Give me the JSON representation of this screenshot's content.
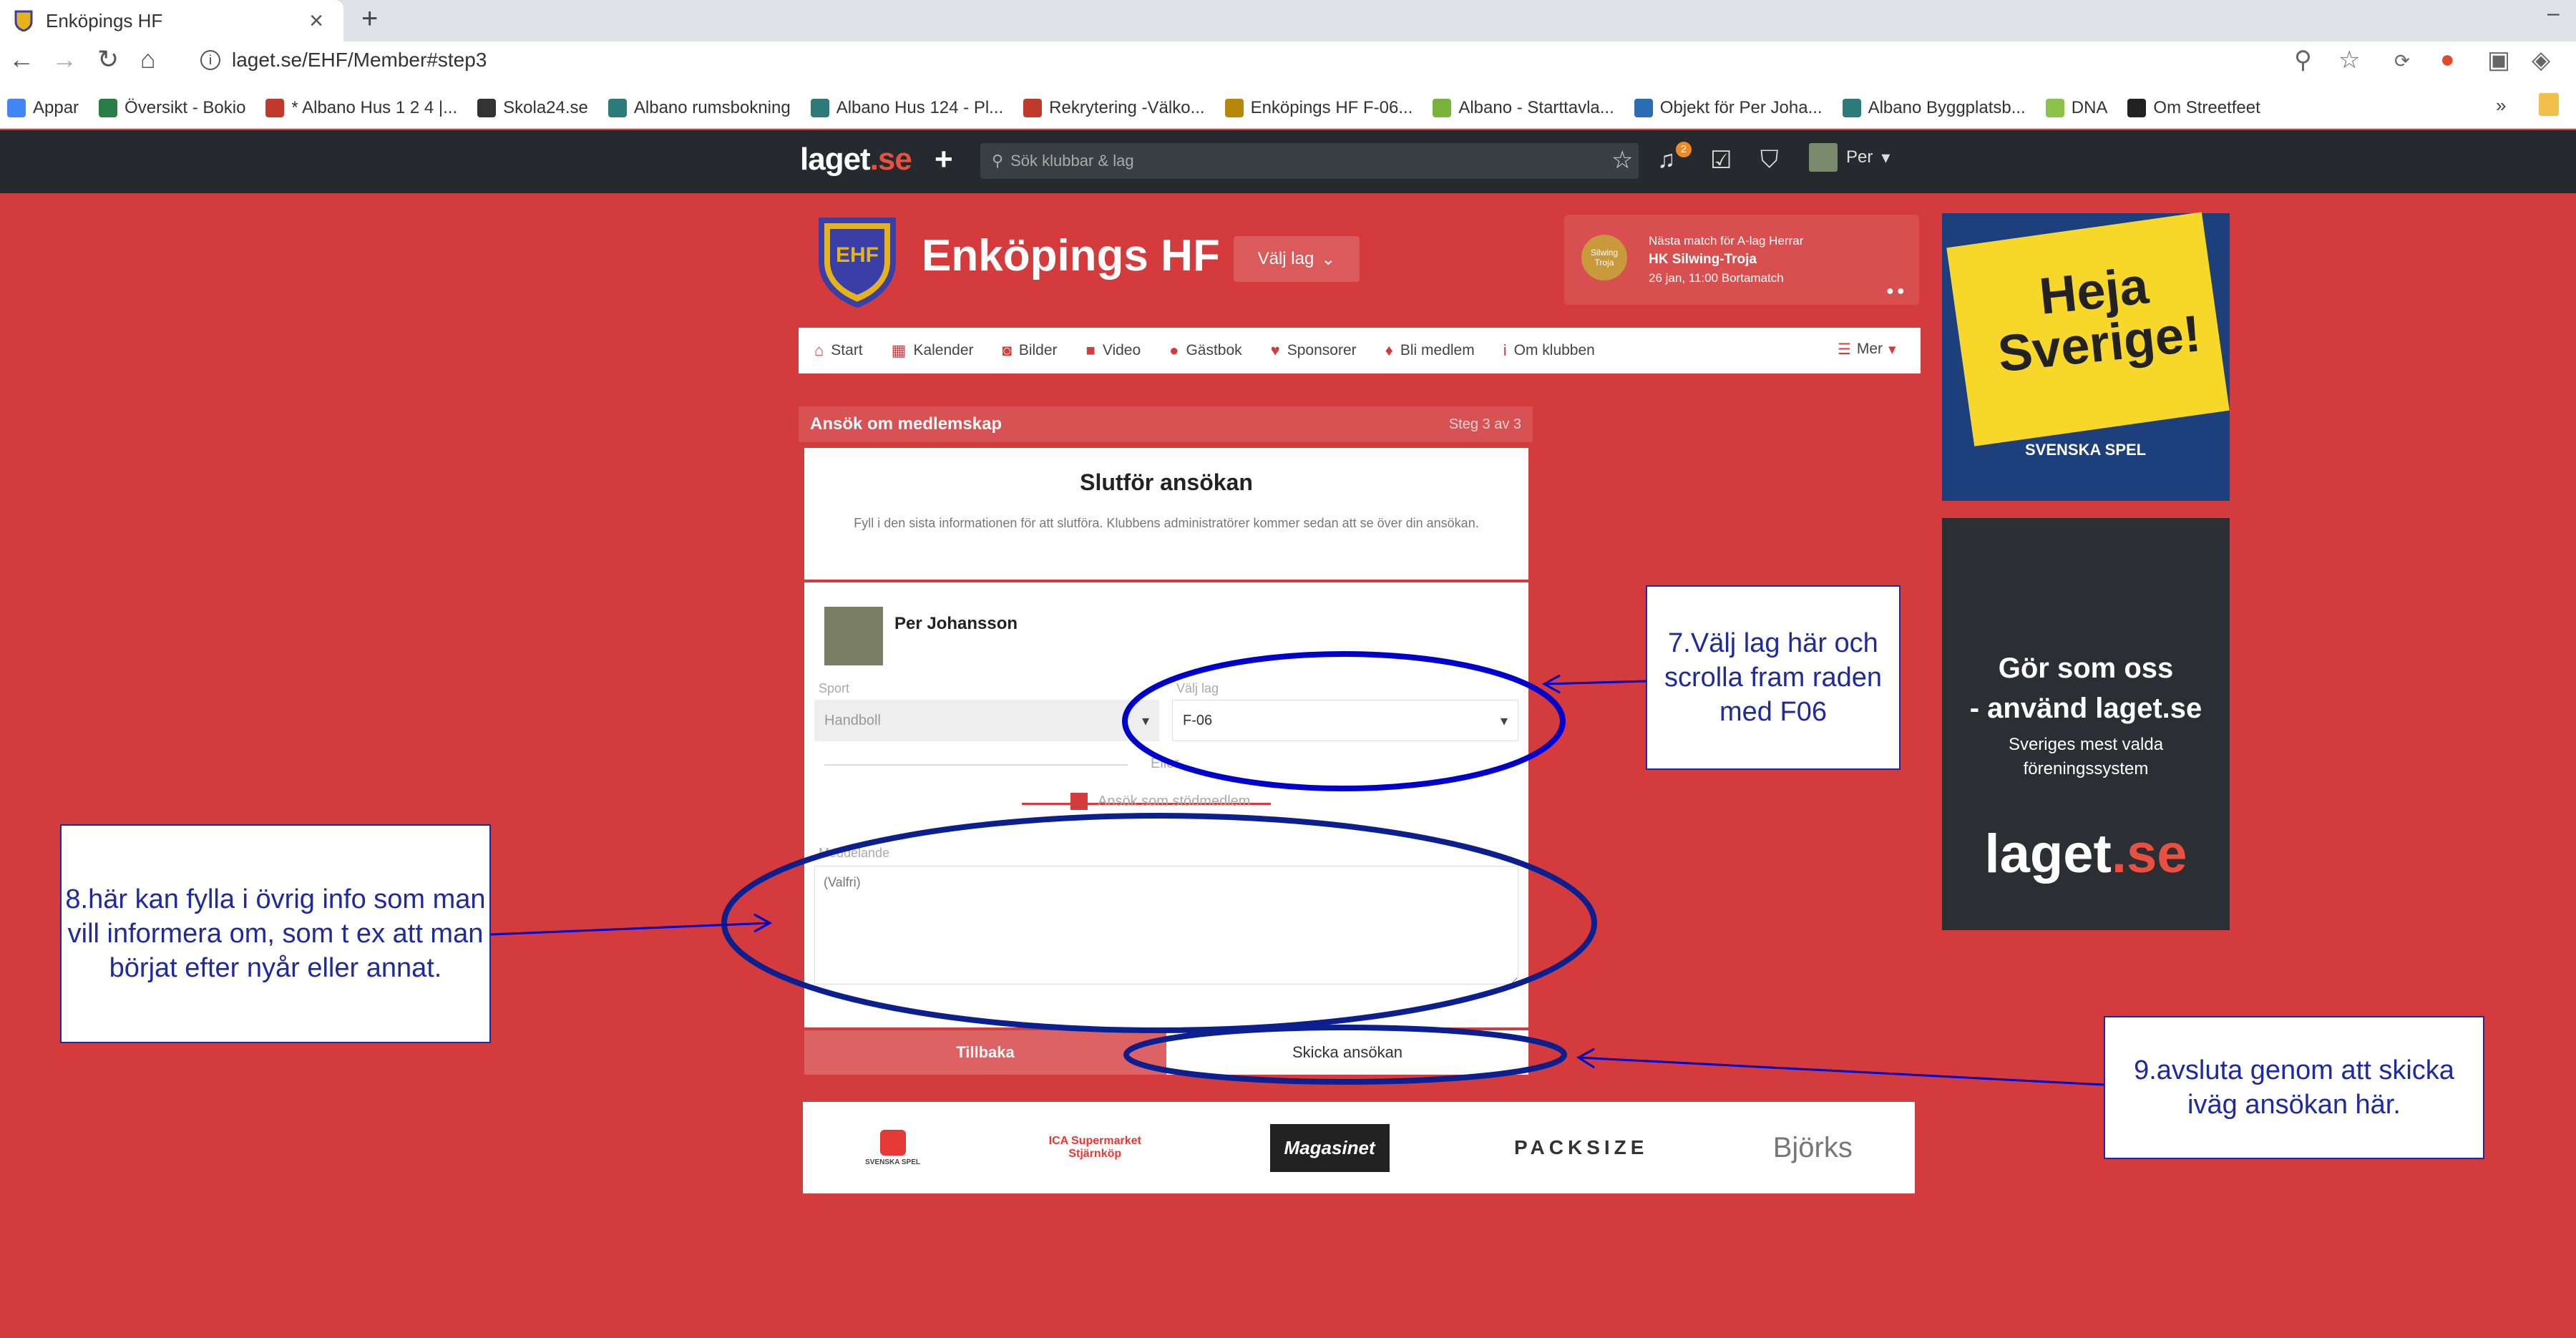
{
  "browser": {
    "tab_title": "Enköpings HF",
    "tab_close": "×",
    "new_tab": "+",
    "url": "laget.se/EHF/Member#step3",
    "bookmarks": [
      {
        "label": "Appar",
        "color": "#4285f4"
      },
      {
        "label": "Översikt - Bokio",
        "color": "#2a7d46"
      },
      {
        "label": "* Albano Hus 1 2 4 |...",
        "color": "#c0392b"
      },
      {
        "label": "Skola24.se",
        "color": "#333333"
      },
      {
        "label": "Albano rumsbokning",
        "color": "#2d7a7a"
      },
      {
        "label": "Albano Hus 124 - Pl...",
        "color": "#2d7a7a"
      },
      {
        "label": "Rekrytering -Välko...",
        "color": "#c0392b"
      },
      {
        "label": "Enköpings HF F-06...",
        "color": "#b8860b"
      },
      {
        "label": "Albano - Starttavla...",
        "color": "#7ab33c"
      },
      {
        "label": "Objekt för Per Joha...",
        "color": "#2a6db5"
      },
      {
        "label": "Albano Byggplatsb...",
        "color": "#2d7a7a"
      },
      {
        "label": "DNA",
        "color": "#8bc34a"
      },
      {
        "label": "Om Streetfeet",
        "color": "#222222"
      }
    ],
    "bookmarks_more": "»"
  },
  "laget": {
    "logo": "laget",
    "logo_suffix": ".se",
    "search_placeholder": "Sök klubbar & lag",
    "notification_count": "2",
    "user_name": "Per"
  },
  "club": {
    "name": "Enköpings HF",
    "crest_letters": "EHF",
    "select_team": "Välj lag",
    "next_match_label": "Nästa match för A-lag Herrar",
    "next_match_teams": "HK Silwing-Troja",
    "next_match_time": "26 jan, 11:00 Bortamatch",
    "next_match_logo": "Silwing Troja"
  },
  "nav": [
    {
      "label": "Start",
      "icon": "home-icon",
      "glyph": "⌂"
    },
    {
      "label": "Kalender",
      "icon": "calendar-icon",
      "glyph": "▦"
    },
    {
      "label": "Bilder",
      "icon": "camera-icon",
      "glyph": "◙"
    },
    {
      "label": "Video",
      "icon": "video-icon",
      "glyph": "■"
    },
    {
      "label": "Gästbok",
      "icon": "chat-icon",
      "glyph": "●"
    },
    {
      "label": "Sponsorer",
      "icon": "heart-icon",
      "glyph": "♥"
    },
    {
      "label": "Bli medlem",
      "icon": "person-icon",
      "glyph": "♦"
    },
    {
      "label": "Om klubben",
      "icon": "info-icon",
      "glyph": "i"
    }
  ],
  "nav_more": "Mer",
  "form": {
    "header": "Ansök om medlemskap",
    "step": "Steg 3 av 3",
    "title": "Slutför ansökan",
    "description": "Fyll i den sista informationen för att slutföra. Klubbens administratörer kommer sedan att se över din ansökan.",
    "member_name": "Per Johansson",
    "sport_label": "Sport",
    "sport_value": "Handboll",
    "team_label": "Välj lag",
    "team_value": "F-06",
    "or_label": "Eller",
    "support_member": "Ansök som stödmedlem",
    "message_label": "Meddelande",
    "message_placeholder": "(Valfri)",
    "back_button": "Tillbaka",
    "send_button": "Skicka ansökan"
  },
  "sponsors": [
    "SVENSKA SPEL",
    "ICA Supermarket Stjärnköp",
    "Magasinet",
    "PACKSIZE",
    "Björks"
  ],
  "ads": {
    "ad1_text": "Heja Sverige!",
    "ad1_brand": "SVENSKA SPEL",
    "ad2_line1": "Gör som oss",
    "ad2_line2": "- använd laget.se",
    "ad2_line3": "Sveriges mest valda",
    "ad2_line4": "föreningssystem",
    "ad2_logo": "laget",
    "ad2_logo_suffix": ".se"
  },
  "annotations": {
    "note7": "7.Välj lag här och scrolla fram raden med F06",
    "note8": "8.här kan fylla i övrig info som man vill informera om, som t ex att man börjat efter nyår eller annat.",
    "note9": "9.avsluta genom att skicka iväg ansökan här.",
    "color": "#0000cc"
  }
}
